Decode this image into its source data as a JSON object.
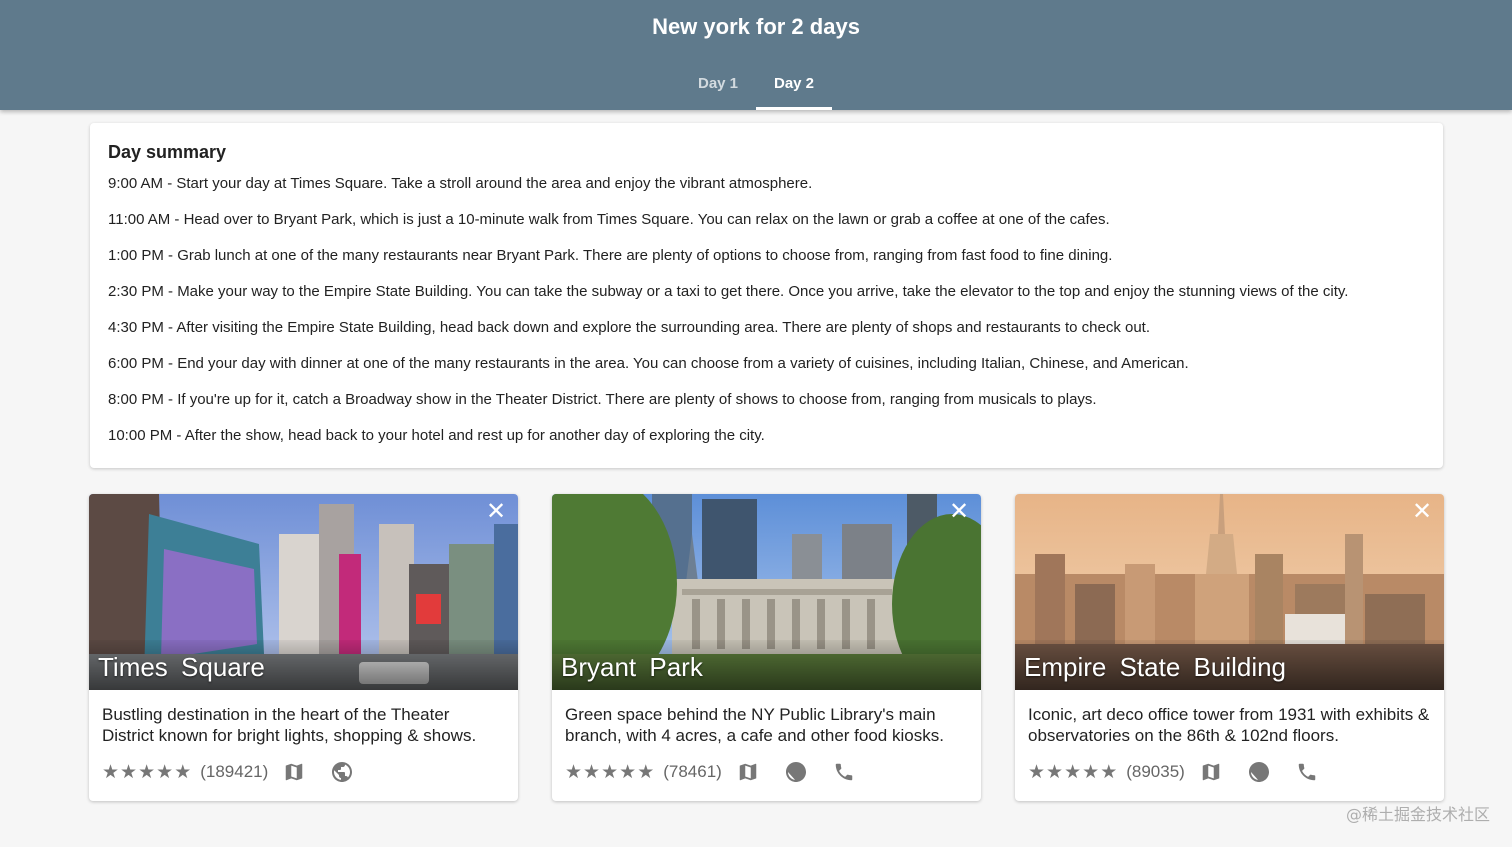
{
  "header": {
    "title": "New york for 2 days",
    "tabs": [
      {
        "label": "Day 1"
      },
      {
        "label": "Day 2"
      }
    ]
  },
  "summary": {
    "heading": "Day summary",
    "items": [
      "9:00 AM - Start your day at Times Square. Take a stroll around the area and enjoy the vibrant atmosphere.",
      "11:00 AM - Head over to Bryant Park, which is just a 10-minute walk from Times Square. You can relax on the lawn or grab a coffee at one of the cafes.",
      "1:00 PM - Grab lunch at one of the many restaurants near Bryant Park. There are plenty of options to choose from, ranging from fast food to fine dining.",
      "2:30 PM - Make your way to the Empire State Building. You can take the subway or a taxi to get there. Once you arrive, take the elevator to the top and enjoy the stunning views of the city.",
      "4:30 PM - After visiting the Empire State Building, head back down and explore the surrounding area. There are plenty of shops and restaurants to check out.",
      "6:00 PM - End your day with dinner at one of the many restaurants in the area. You can choose from a variety of cuisines, including Italian, Chinese, and American.",
      "8:00 PM - If you're up for it, catch a Broadway show in the Theater District. There are plenty of shows to choose from, ranging from musicals to plays.",
      "10:00 PM - After the show, head back to your hotel and rest up for another day of exploring the city."
    ]
  },
  "places": [
    {
      "name": "Times Square",
      "description": "Bustling destination in the heart of the Theater District known for bright lights, shopping & shows.",
      "rating": 4.5,
      "reviews": "(189421)",
      "actions": [
        "map-icon",
        "globe-icon"
      ]
    },
    {
      "name": "Bryant Park",
      "description": "Green space behind the NY Public Library's main branch, with 4 acres, a cafe and other food kiosks.",
      "rating": 4.5,
      "reviews": "(78461)",
      "actions": [
        "map-icon",
        "globe-icon",
        "phone-icon"
      ]
    },
    {
      "name": "Empire State Building",
      "description": "Iconic, art deco office tower from 1931 with exhibits & observatories on the 86th & 102nd floors.",
      "rating": 4.5,
      "reviews": "(89035)",
      "actions": [
        "map-icon",
        "globe-icon",
        "phone-icon"
      ]
    }
  ],
  "close_symbol": "✕",
  "watermark": "@稀土掘金技术社区",
  "colors": {
    "header_bg": "#5f7a8c",
    "page_bg": "#f6f6f6",
    "icon_gray": "#777777"
  }
}
